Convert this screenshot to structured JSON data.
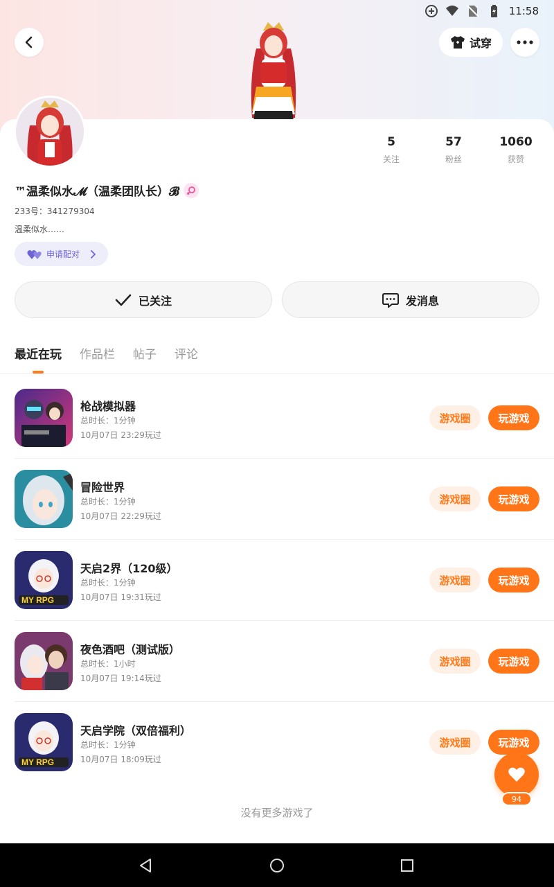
{
  "status_bar": {
    "time": "11:58",
    "icons": [
      "data-saver-icon",
      "wifi-icon",
      "no-sim-icon",
      "battery-charging-icon"
    ]
  },
  "header": {
    "back_icon": "chevron-left-icon",
    "tryon_label": "试穿",
    "tryon_icon": "shirt-icon",
    "more_icon": "more-dots-icon"
  },
  "profile": {
    "username": "™温柔似水𝓜（温柔团队长）𝓑",
    "gender_icon": "female-icon",
    "uid": "233号：341279304",
    "bio": "温柔似水……",
    "match_label": "申请配对",
    "stats": [
      {
        "num": "5",
        "label": "关注"
      },
      {
        "num": "57",
        "label": "粉丝"
      },
      {
        "num": "1060",
        "label": "获赞"
      }
    ]
  },
  "actions": {
    "follow_label": "已关注",
    "message_label": "发消息"
  },
  "tabs": [
    {
      "label": "最近在玩",
      "active": true
    },
    {
      "label": "作品栏",
      "active": false
    },
    {
      "label": "帖子",
      "active": false
    },
    {
      "label": "评论",
      "active": false
    }
  ],
  "games": [
    {
      "name": "枪战模拟器",
      "duration": "总时长：1分钟",
      "last_played": "10月07日 23:29玩过",
      "circle_label": "游戏圈",
      "play_label": "玩游戏"
    },
    {
      "name": "冒险世界",
      "duration": "总时长：1分钟",
      "last_played": "10月07日 22:29玩过",
      "circle_label": "游戏圈",
      "play_label": "玩游戏"
    },
    {
      "name": "天启2界（120级）",
      "duration": "总时长：1分钟",
      "last_played": "10月07日 19:31玩过",
      "circle_label": "游戏圈",
      "play_label": "玩游戏"
    },
    {
      "name": "夜色酒吧（测试版）",
      "duration": "总时长：1小时",
      "last_played": "10月07日 19:14玩过",
      "circle_label": "游戏圈",
      "play_label": "玩游戏"
    },
    {
      "name": "天启学院（双倍福利）",
      "duration": "总时长：1分钟",
      "last_played": "10月07日 18:09玩过",
      "circle_label": "游戏圈",
      "play_label": "玩游戏"
    }
  ],
  "footer": {
    "no_more": "没有更多游戏了"
  },
  "like": {
    "count": "94"
  },
  "colors": {
    "accent": "#ff7518",
    "accent_light": "#fff0e5",
    "match_purple": "#6f63d6"
  }
}
